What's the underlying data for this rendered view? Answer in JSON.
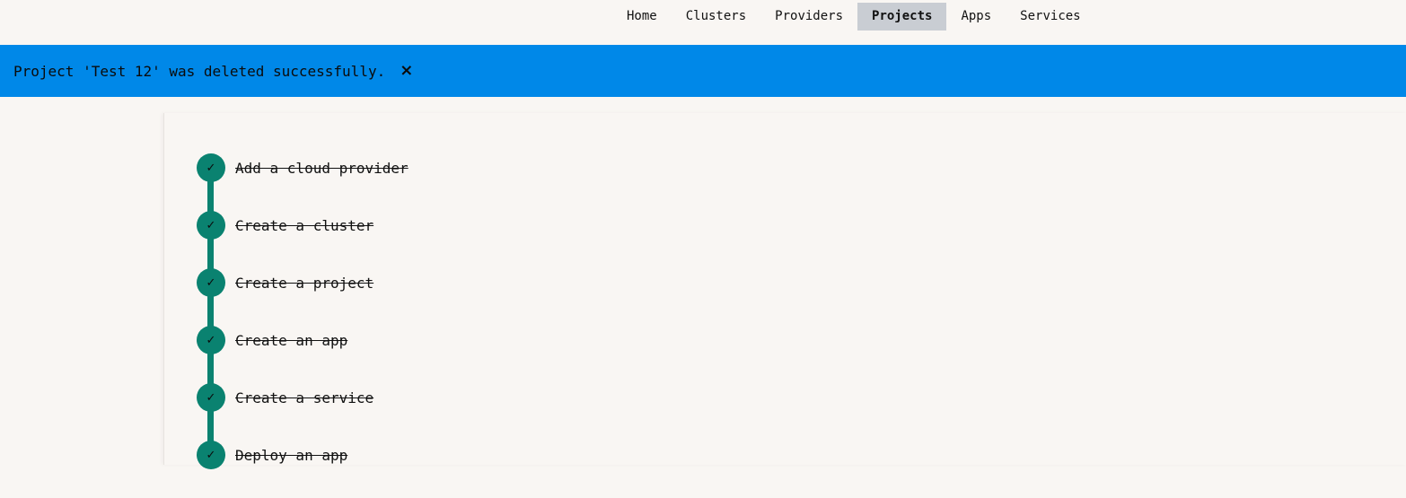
{
  "nav": {
    "items": [
      {
        "label": "Home",
        "active": false
      },
      {
        "label": "Clusters",
        "active": false
      },
      {
        "label": "Providers",
        "active": false
      },
      {
        "label": "Projects",
        "active": true
      },
      {
        "label": "Apps",
        "active": false
      },
      {
        "label": "Services",
        "active": false
      }
    ]
  },
  "banner": {
    "message": "Project 'Test 12' was deleted successfully.",
    "close_icon": "×",
    "color": "#0088e8"
  },
  "steps": {
    "items": [
      {
        "label": "Add a cloud provider",
        "completed": true,
        "icon": "check-icon"
      },
      {
        "label": "Create a cluster",
        "completed": true,
        "icon": "check-icon"
      },
      {
        "label": "Create a project",
        "completed": true,
        "icon": "check-icon"
      },
      {
        "label": "Create an app",
        "completed": true,
        "icon": "check-icon"
      },
      {
        "label": "Create a service",
        "completed": true,
        "icon": "check-icon"
      },
      {
        "label": "Deploy an app",
        "completed": true,
        "icon": "check-icon"
      }
    ],
    "check_glyph": "✓",
    "accent_color": "#0a8270"
  }
}
